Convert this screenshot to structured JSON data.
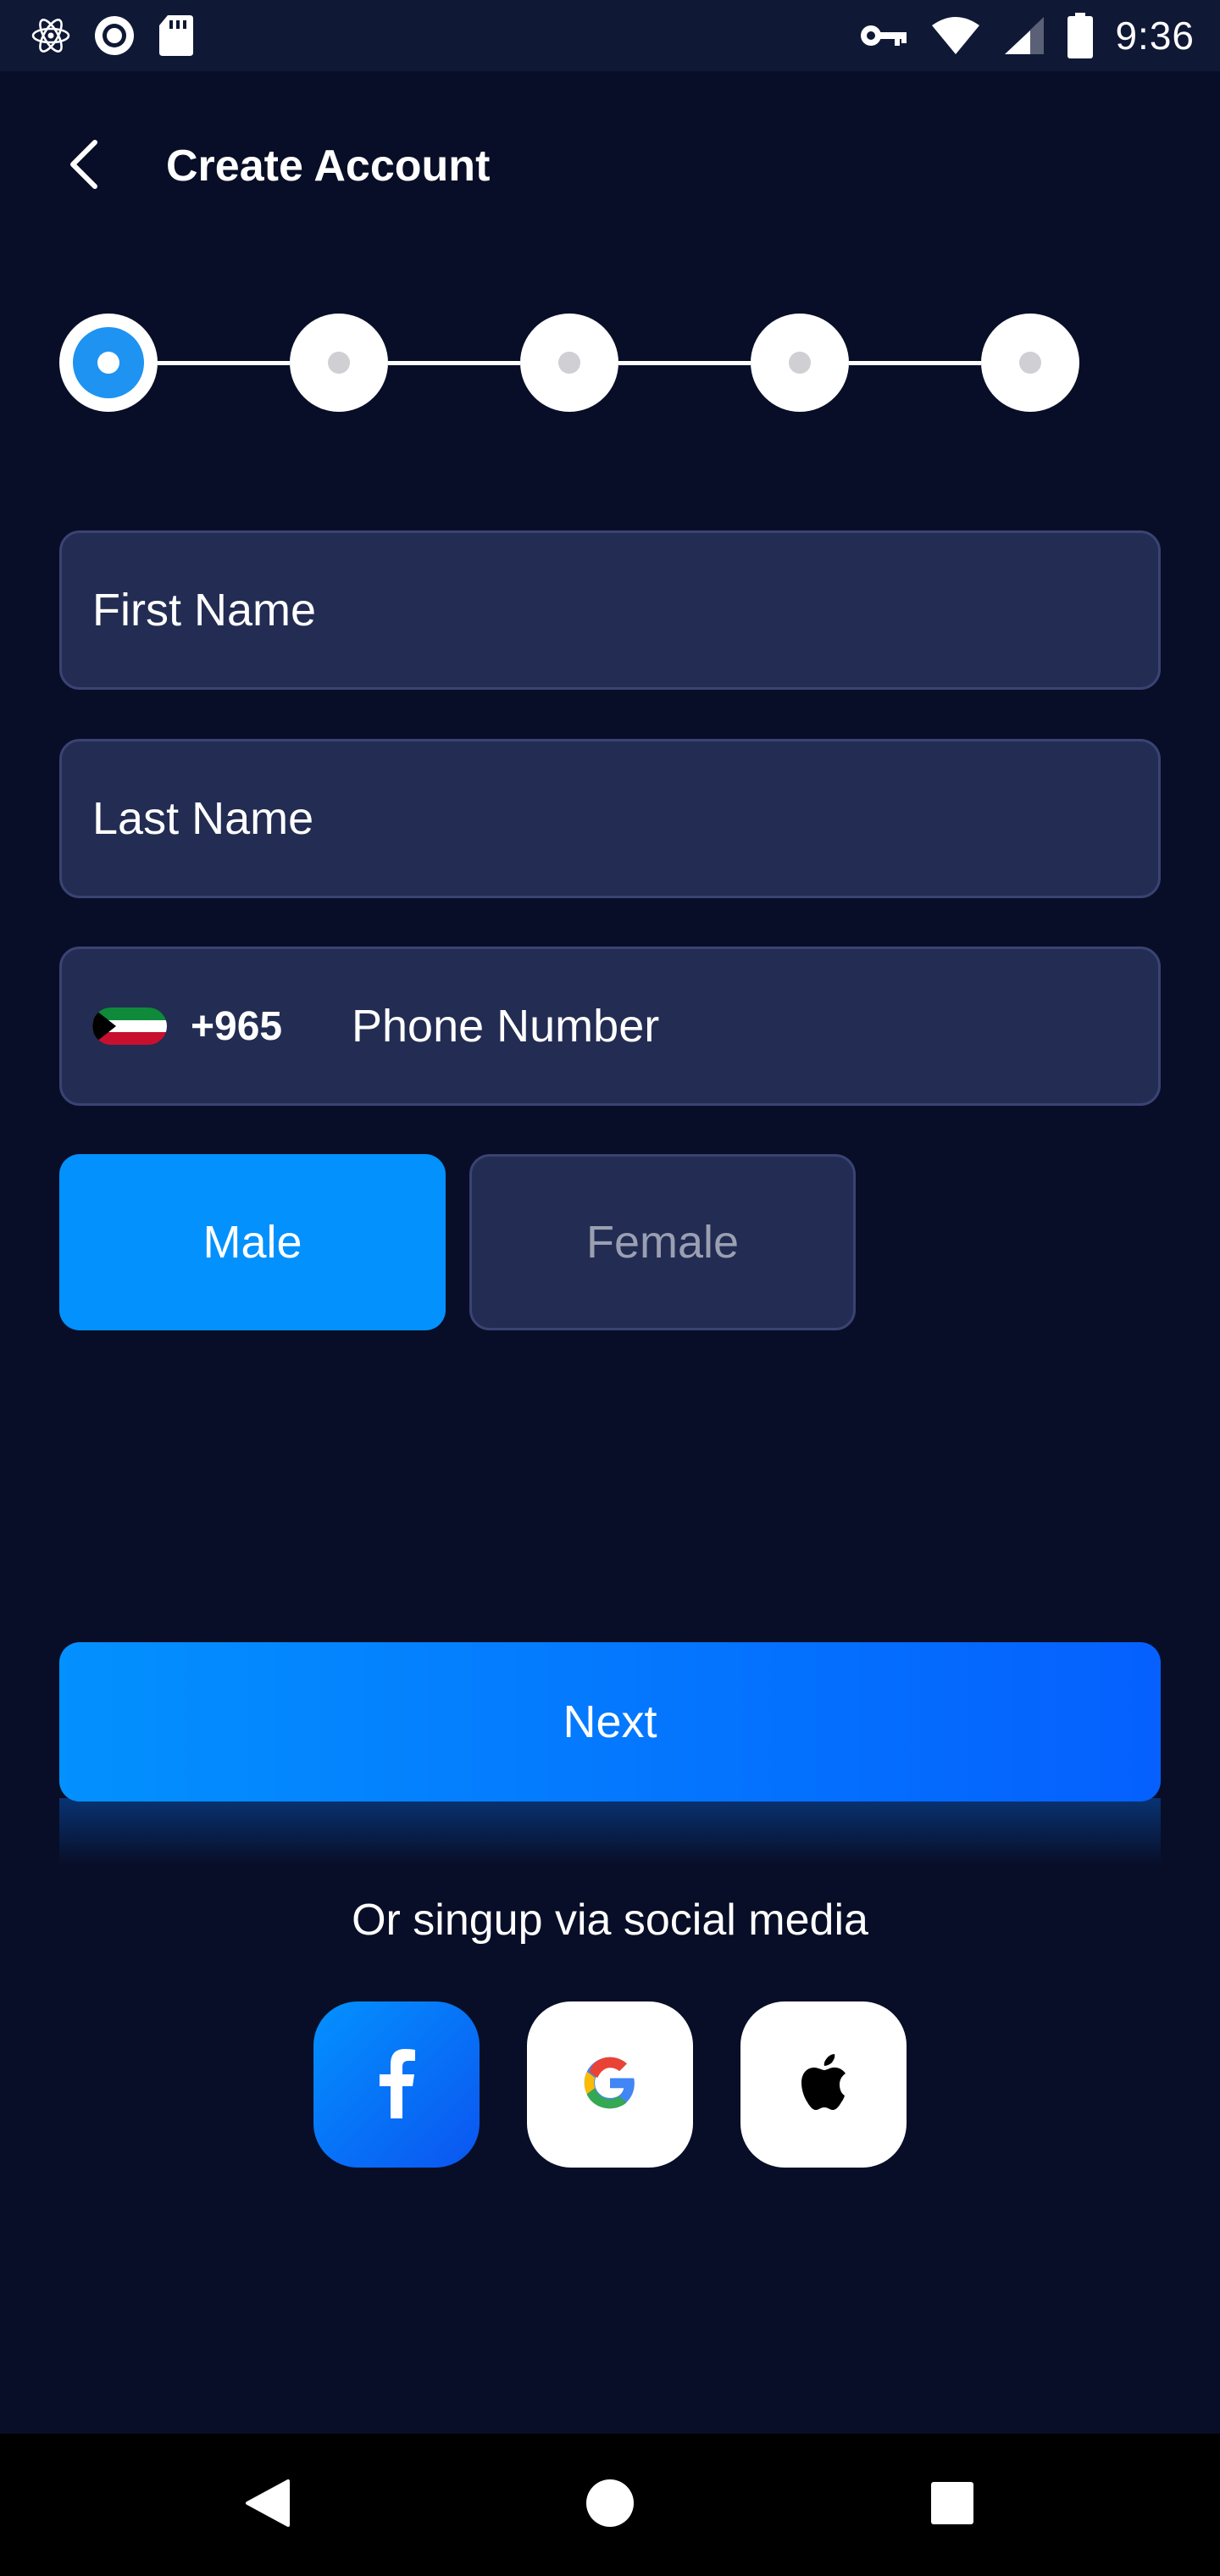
{
  "status_bar": {
    "time": "9:36",
    "left_icons": [
      "react-icon",
      "record-icon",
      "sd-card-icon"
    ],
    "right_icons": [
      "key-icon",
      "wifi-icon",
      "signal-icon",
      "battery-icon"
    ]
  },
  "header": {
    "title": "Create Account",
    "back_icon": "chevron-left-icon"
  },
  "stepper": {
    "total_steps": 5,
    "current_step": 1
  },
  "form": {
    "first_name": {
      "placeholder": "First Name",
      "value": ""
    },
    "last_name": {
      "placeholder": "Last Name",
      "value": ""
    },
    "phone": {
      "flag": "kuwait-flag-icon",
      "dial_code": "+965",
      "placeholder": "Phone Number",
      "value": ""
    },
    "gender": {
      "options": [
        "Male",
        "Female"
      ],
      "selected": "Male"
    }
  },
  "actions": {
    "next_label": "Next"
  },
  "social": {
    "caption": "Or singup via social media",
    "buttons": [
      "facebook-icon",
      "google-icon",
      "apple-icon"
    ]
  },
  "colors": {
    "background": "#080E27",
    "field_bg": "#232C52",
    "field_border": "#3A4373",
    "accent": "#0391FE",
    "accent_end": "#0560FE",
    "muted_text": "#9A9FB2"
  }
}
